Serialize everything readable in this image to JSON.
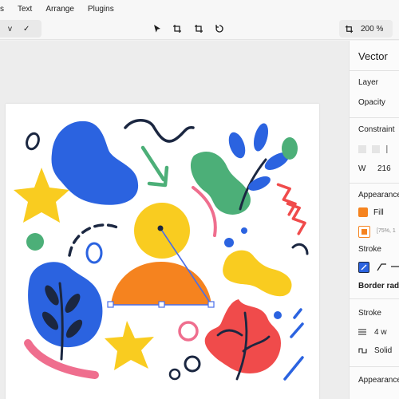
{
  "menubar": {
    "items": [
      "s",
      "Text",
      "Arrange",
      "Plugins"
    ]
  },
  "toolbar": {
    "left_label": "v",
    "left_check": "✓",
    "tools": [
      "move-tool",
      "frame-tool",
      "crop-tool",
      "rotate-tool"
    ],
    "zoom": "200 %"
  },
  "panel": {
    "title": "Vector",
    "layer_heading": "Layer",
    "opacity_label": "Opacity",
    "constraint_heading": "Constraint",
    "width_label": "W",
    "width_value": "216",
    "appearance_heading": "Appearance",
    "fill_label": "Fill",
    "fill_value": "[75%, 1",
    "stroke_label": "Stroke",
    "border_radius_label": "Border radius",
    "stroke_heading": "Stroke",
    "stroke_weight": "4 w",
    "stroke_style": "Solid",
    "appearance_heading_2": "Appearance"
  },
  "colors": {
    "blue": "#2b63e0",
    "yellow": "#f9cc20",
    "green": "#4caf78",
    "orange": "#f5831f",
    "pink": "#ef6e8e",
    "red": "#f04b4b",
    "navy": "#1b2741",
    "selection": "#4a6ee8",
    "fill_swatch": "#f5831f"
  }
}
